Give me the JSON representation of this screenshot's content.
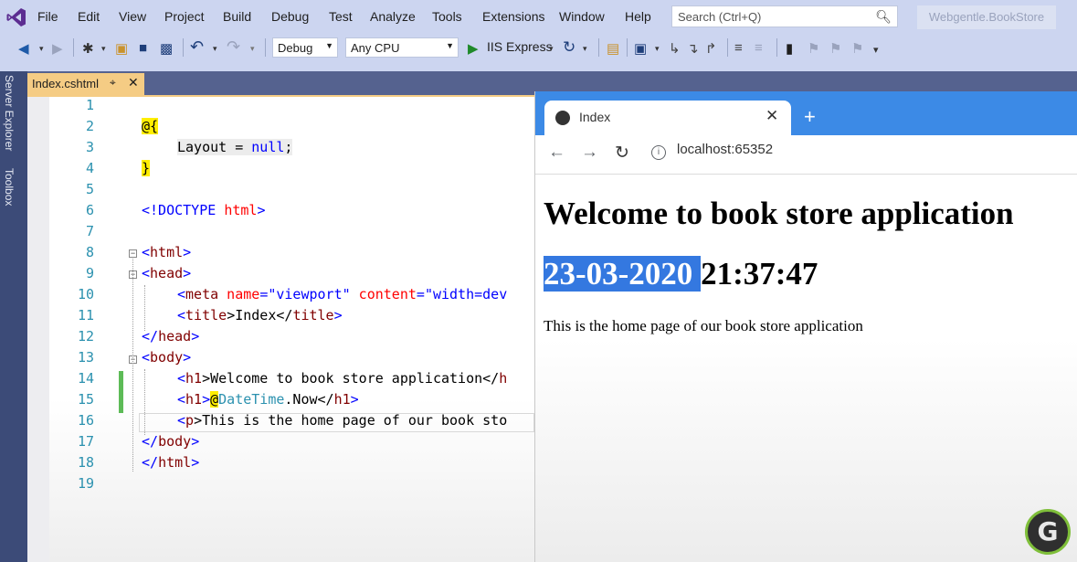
{
  "menu": [
    "File",
    "Edit",
    "View",
    "Project",
    "Build",
    "Debug",
    "Test",
    "Analyze",
    "Tools",
    "Extensions",
    "Window",
    "Help"
  ],
  "search": {
    "placeholder": "Search (Ctrl+Q)"
  },
  "solution_name": "Webgentle.BookStore",
  "toolbar": {
    "config": "Debug",
    "platform": "Any CPU",
    "run_label": "IIS Express"
  },
  "side_tabs": [
    "Server Explorer",
    "Toolbox"
  ],
  "editor": {
    "tab_title": "Index.cshtml",
    "line_numbers": [
      "1",
      "2",
      "3",
      "4",
      "5",
      "6",
      "7",
      "8",
      "9",
      "10",
      "11",
      "12",
      "13",
      "14",
      "15",
      "16",
      "17",
      "18",
      "19"
    ],
    "code": {
      "l2": "@{",
      "l3_a": "Layout = ",
      "l3_b": "null",
      "l3_c": ";",
      "l4": "}",
      "l6_a": "<!DOCTYPE ",
      "l6_b": "html",
      "l6_c": ">",
      "l8_a": "<",
      "l8_b": "html",
      "l8_c": ">",
      "l9_a": "<",
      "l9_b": "head",
      "l9_c": ">",
      "l10_a": "<",
      "l10_b": "meta",
      "l10_c": " name",
      "l10_d": "=",
      "l10_e": "\"viewport\"",
      "l10_f": " content",
      "l10_g": "=",
      "l10_h": "\"width=dev",
      "l11_a": "<",
      "l11_b": "title",
      "l11_c": ">Index</",
      "l11_d": "title",
      "l11_e": ">",
      "l12_a": "</",
      "l12_b": "head",
      "l12_c": ">",
      "l13_a": "<",
      "l13_b": "body",
      "l13_c": ">",
      "l14_a": "<",
      "l14_b": "h1",
      "l14_c": ">Welcome to book store application</",
      "l14_d": "h",
      "l15_a": "<",
      "l15_b": "h1",
      "l15_c": ">",
      "l15_d": "@",
      "l15_e": "DateTime",
      "l15_f": ".Now</",
      "l15_g": "h1",
      "l15_h": ">",
      "l16_a": "<",
      "l16_b": "p",
      "l16_c": ">This is the home page of our book sto",
      "l17_a": "</",
      "l17_b": "body",
      "l17_c": ">",
      "l18_a": "</",
      "l18_b": "html",
      "l18_c": ">"
    }
  },
  "browser": {
    "tab_title": "Index",
    "url": "localhost:65352",
    "heading": "Welcome to book store application",
    "datetime_selected": "23-03-2020 ",
    "datetime_rest": "21:37:47",
    "paragraph": "This is the home page of our book store application"
  },
  "watermark_letter": "G"
}
